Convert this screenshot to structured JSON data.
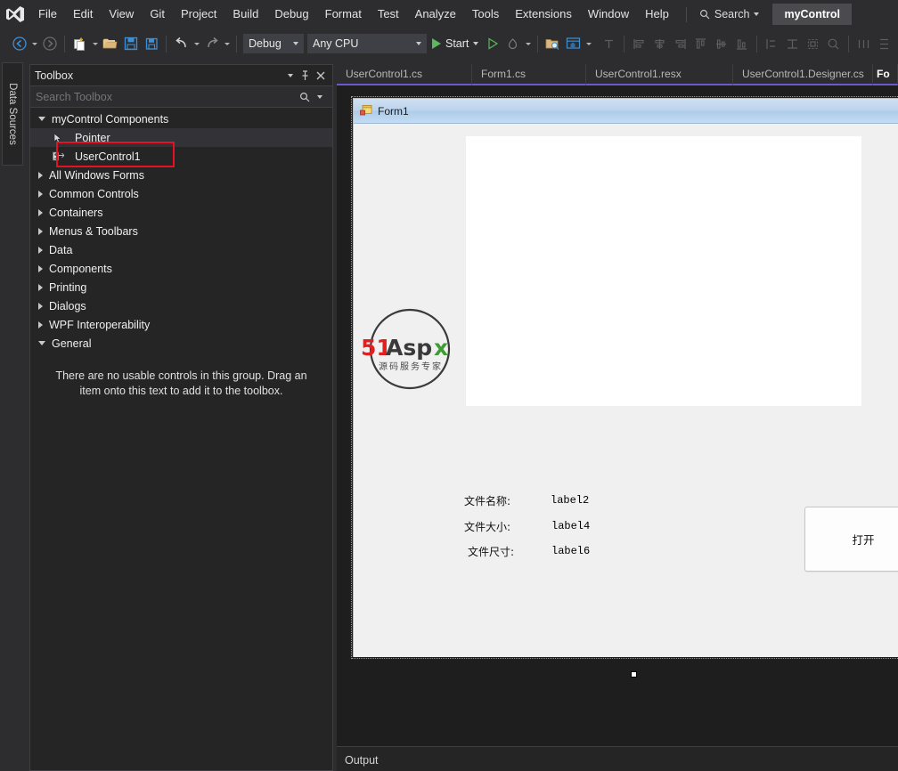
{
  "menubar": {
    "logo_icon": "visual-studio-logo",
    "items": [
      "File",
      "Edit",
      "View",
      "Git",
      "Project",
      "Build",
      "Debug",
      "Format",
      "Test",
      "Analyze",
      "Tools",
      "Extensions",
      "Window",
      "Help"
    ],
    "search": {
      "label": "Search",
      "icon": "search-icon"
    },
    "project_chip": "myControl"
  },
  "toolbar": {
    "nav_back_icon": "back-arrow-icon",
    "nav_forward_icon": "forward-arrow-icon",
    "new_item_icon": "new-item-icon",
    "open_icon": "open-folder-icon",
    "save_icon": "save-icon",
    "save_all_icon": "save-all-icon",
    "undo_icon": "undo-icon",
    "redo_icon": "redo-icon",
    "config_value": "Debug",
    "platform_value": "Any CPU",
    "start_label": "Start",
    "start_icon": "play-icon",
    "attach_icon": "play-outline-icon",
    "hot_reload_icon": "hot-reload-icon",
    "solution_explorer_icon": "find-in-files-icon",
    "properties_icon": "properties-window-icon",
    "align_icons": [
      "tab-order-icon",
      "align-left-icon",
      "align-center-icon",
      "align-right-icon",
      "align-top-icon",
      "align-middle-icon",
      "align-bottom-icon",
      "make-same-width-icon",
      "make-same-height-icon",
      "size-to-grid-icon",
      "zoom-icon",
      "horizontal-spacing-icon",
      "vertical-spacing-icon",
      "bring-to-front-icon"
    ]
  },
  "left_dock": {
    "vertical_tab": "Data Sources"
  },
  "toolbox": {
    "title": "Toolbox",
    "dropdown_icon": "chevron-down-icon",
    "pin_icon": "pin-icon",
    "close_icon": "close-icon",
    "search_placeholder": "Search Toolbox",
    "search_value": "",
    "search_icon": "search-icon",
    "search_dropdown_icon": "chevron-down-icon",
    "tree": [
      {
        "label": "myControl Components",
        "expanded": true,
        "type": "group"
      },
      {
        "label": "Pointer",
        "type": "leaf",
        "icon": "pointer-icon",
        "selected": true
      },
      {
        "label": "UserControl1",
        "type": "leaf",
        "icon": "usercontrol-icon",
        "selected": false,
        "highlighted": true
      },
      {
        "label": "All Windows Forms",
        "expanded": false,
        "type": "group"
      },
      {
        "label": "Common Controls",
        "expanded": false,
        "type": "group"
      },
      {
        "label": "Containers",
        "expanded": false,
        "type": "group"
      },
      {
        "label": "Menus & Toolbars",
        "expanded": false,
        "type": "group"
      },
      {
        "label": "Data",
        "expanded": false,
        "type": "group"
      },
      {
        "label": "Components",
        "expanded": false,
        "type": "group"
      },
      {
        "label": "Printing",
        "expanded": false,
        "type": "group"
      },
      {
        "label": "Dialogs",
        "expanded": false,
        "type": "group"
      },
      {
        "label": "WPF Interoperability",
        "expanded": false,
        "type": "group"
      },
      {
        "label": "General",
        "expanded": true,
        "type": "group"
      }
    ],
    "empty_message": "There are no usable controls in this group. Drag an item onto this text to add it to the toolbox.",
    "highlight_color": "#e81123"
  },
  "document_tabs": [
    {
      "label": "UserControl1.cs",
      "active": false
    },
    {
      "label": "Form1.cs",
      "active": false
    },
    {
      "label": "UserControl1.resx",
      "active": false
    },
    {
      "label": "UserControl1.Designer.cs",
      "active": false
    },
    {
      "label": "Fo",
      "active": true
    }
  ],
  "designer": {
    "form_title": "Form1",
    "form_icon": "windows-form-icon",
    "watermark": {
      "text": "51Aspx",
      "subtext": "源码服务专家"
    },
    "picturebox": {
      "name": "pictureBox1"
    },
    "fields": [
      {
        "caption": "文件名称:",
        "value": "label2"
      },
      {
        "caption": "文件大小:",
        "value": "label4"
      },
      {
        "caption": "文件尺寸:",
        "value": "label6"
      }
    ],
    "open_button": "打开",
    "resize_handle": "bottom-center-sizer"
  },
  "output": {
    "tab_label": "Output"
  },
  "colors": {
    "shell_bg": "#2d2d30",
    "panel_bg": "#252526",
    "editor_bg": "#1e1e1e",
    "accent_purple": "#6a5acd",
    "highlight_red": "#e81123",
    "start_green": "#5cb85c",
    "form_chrome": "#bcd4ed"
  }
}
